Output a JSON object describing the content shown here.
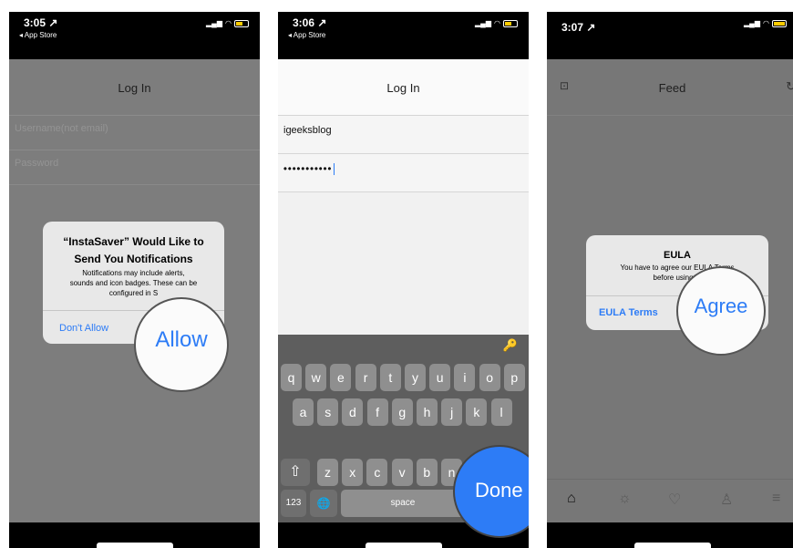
{
  "phones": [
    {
      "status": {
        "time": "3:05 ↗",
        "back": "◂ App Store"
      },
      "nav_title": "Log In",
      "username_placeholder": "Username(not email)",
      "password_placeholder": "Password",
      "alert": {
        "title_line1": "“InstaSaver” Would Like to",
        "title_line2": "Send You Notifications",
        "message_line1": "Notifications may include alerts,",
        "message_line2": "sounds and icon badges. These can be",
        "message_line3": "configured in S",
        "deny_label": "Don't Allow",
        "allow_label": "Allow"
      }
    },
    {
      "status": {
        "time": "3:06 ↗",
        "back": "◂ App Store"
      },
      "nav_title": "Log In",
      "username_value": "igeeksblog",
      "password_value": "•••••••••••",
      "keyboard": {
        "row1": [
          "q",
          "w",
          "e",
          "r",
          "t",
          "y",
          "u",
          "i",
          "o",
          "p"
        ],
        "row2": [
          "a",
          "s",
          "d",
          "f",
          "g",
          "h",
          "j",
          "k",
          "l"
        ],
        "row3": [
          "z",
          "x",
          "c",
          "v",
          "b",
          "n"
        ],
        "numbers_label": "123",
        "globe": "🌐",
        "space_label": "space",
        "done_label": "Done",
        "key_icon": "🔑",
        "shift": "⇧"
      }
    },
    {
      "status": {
        "time": "3:07 ↗"
      },
      "nav_title": "Feed",
      "alert": {
        "title": "EULA",
        "message_line1": "You have to agree our EULA Terms",
        "message_line2": "before using th",
        "terms_label": "EULA Terms",
        "agree_label": "Agree"
      },
      "tabs": [
        "home-icon",
        "sun-icon",
        "heart-icon",
        "user-icon",
        "menu-icon"
      ]
    }
  ],
  "colors": {
    "ios_blue": "#2d7cf6",
    "battery": "#ffcc00"
  }
}
